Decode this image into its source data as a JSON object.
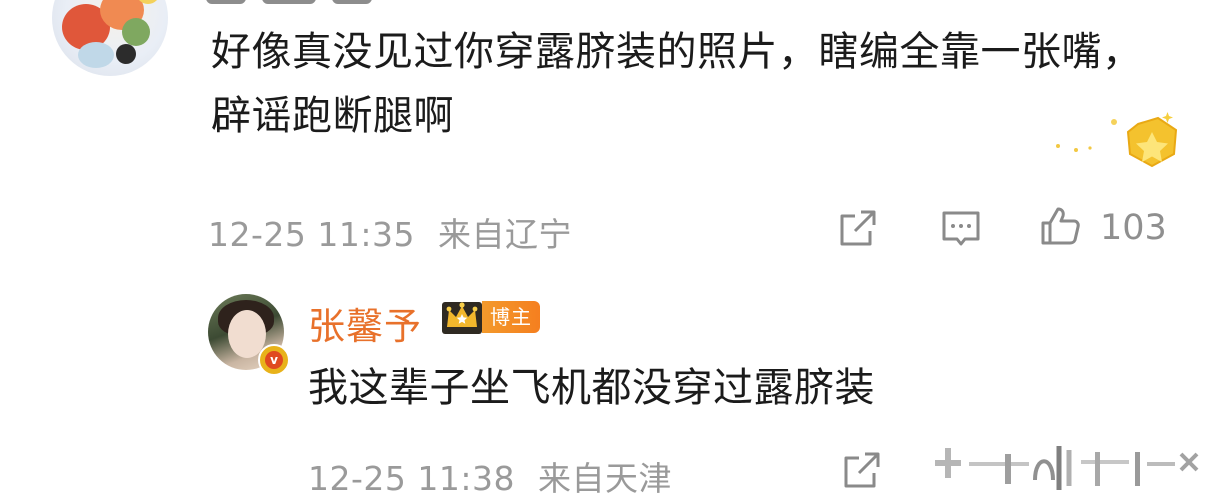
{
  "comment": {
    "text": "好像真没见过你穿露脐装的照片，瞎编全靠一张嘴，辟谣跑断腿啊",
    "time": "12-25 11:35",
    "location": "来自辽宁",
    "like_count": "103",
    "icons": [
      "share-icon",
      "reply-icon",
      "like-icon"
    ]
  },
  "reply": {
    "author": "张馨予",
    "tag": "博主",
    "text": "我这辈子坐飞机都没穿过露脐装",
    "time": "12-25 11:38",
    "location": "来自天津",
    "icons": [
      "share-icon",
      "verified-badge-icon",
      "crown-icon"
    ]
  },
  "colors": {
    "author_name": "#e8712b",
    "meta_gray": "#9a9a9a",
    "text": "#1b1b1b",
    "tag_bg": "#f5801f"
  }
}
